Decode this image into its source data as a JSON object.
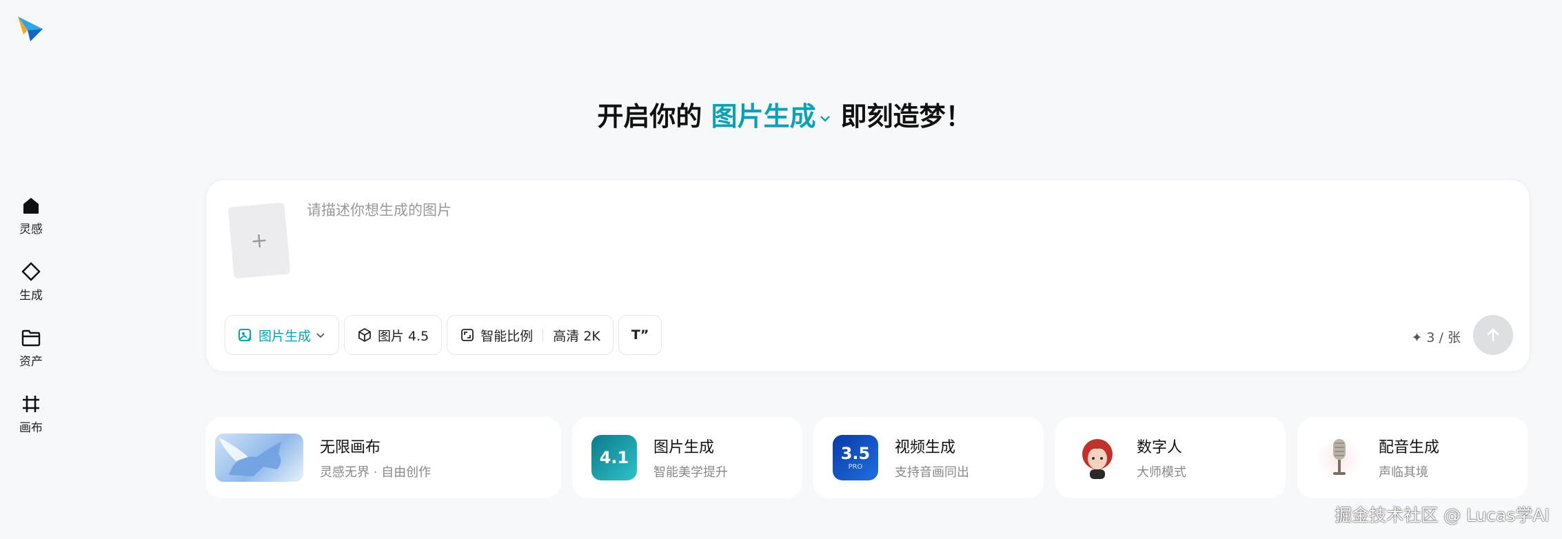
{
  "brand": {
    "logo_icon": "paper-plane-logo"
  },
  "rail": {
    "items": [
      {
        "label": "灵感",
        "icon": "home-icon"
      },
      {
        "label": "生成",
        "icon": "diamond-icon"
      },
      {
        "label": "资产",
        "icon": "folder-icon"
      },
      {
        "label": "画布",
        "icon": "hash-frame-icon"
      }
    ]
  },
  "headline": {
    "prefix": "开启你的",
    "mode": "图片生成",
    "suffix": "即刻造梦！"
  },
  "prompt": {
    "placeholder": "请描述你想生成的图片",
    "value": "",
    "upload_glyph": "+"
  },
  "toolbar": {
    "mode_label": "图片生成",
    "model_label": "图片 4.5",
    "ratio_label": "智能比例",
    "quality_label": "高清 2K",
    "text_tool_label": "T”"
  },
  "credits": {
    "text": "✦ 3 / 张"
  },
  "colors": {
    "accent": "#0aa1b7",
    "send_disabled": "#dedfe2"
  },
  "features": [
    {
      "title": "无限画布",
      "subtitle": "灵感无界 · 自由创作",
      "thumb": "pegasus-image"
    },
    {
      "title": "图片生成",
      "subtitle": "智能美学提升",
      "thumb_text": "4.1"
    },
    {
      "title": "视频生成",
      "subtitle": "支持音画同出",
      "thumb_text": "3.5",
      "thumb_sub": "PRO"
    },
    {
      "title": "数字人",
      "subtitle": "大师模式",
      "thumb": "avatar-girl-image"
    },
    {
      "title": "配音生成",
      "subtitle": "声临其境",
      "thumb": "microphone-image"
    }
  ],
  "watermark": "掘金技术社区 @ Lucas学AI"
}
